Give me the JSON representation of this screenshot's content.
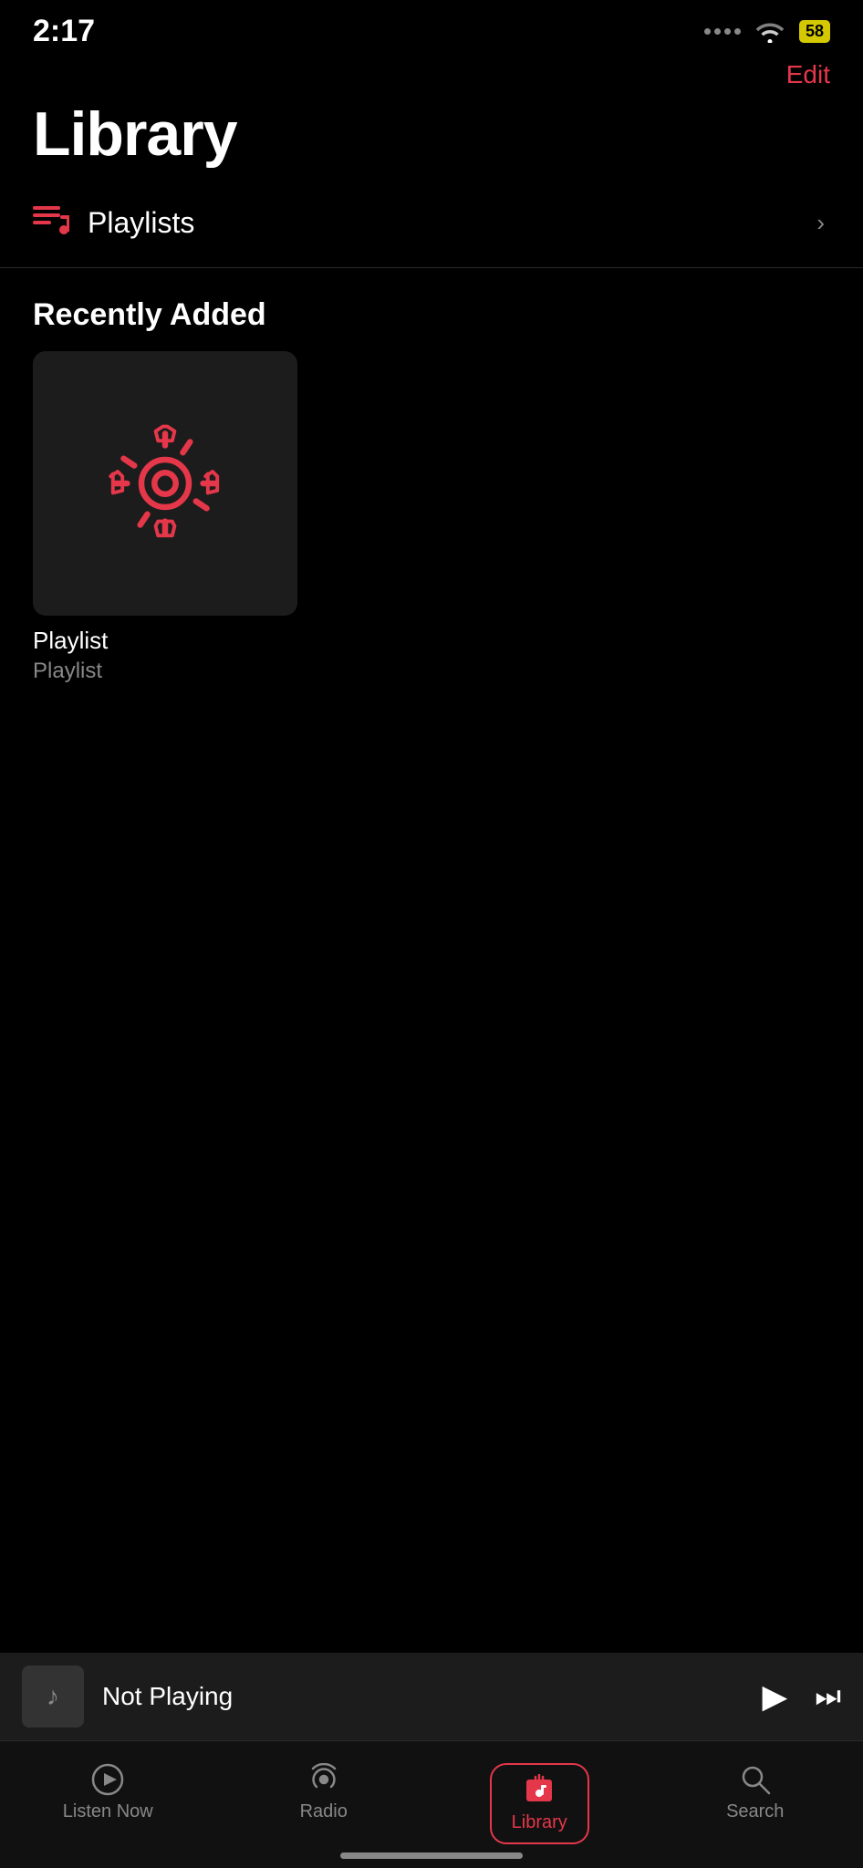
{
  "statusBar": {
    "time": "2:17",
    "battery": "58"
  },
  "header": {
    "editLabel": "Edit"
  },
  "pageTitle": "Library",
  "playlists": {
    "label": "Playlists"
  },
  "recentlyAdded": {
    "sectionTitle": "Recently Added",
    "albums": [
      {
        "title": "Playlist",
        "subtitle": "Playlist"
      }
    ]
  },
  "nowPlaying": {
    "title": "Not Playing"
  },
  "tabBar": {
    "items": [
      {
        "label": "Listen Now",
        "icon": "▶"
      },
      {
        "label": "Radio",
        "icon": "radio"
      },
      {
        "label": "Library",
        "icon": "library",
        "active": true
      },
      {
        "label": "Search",
        "icon": "🔍"
      }
    ]
  }
}
